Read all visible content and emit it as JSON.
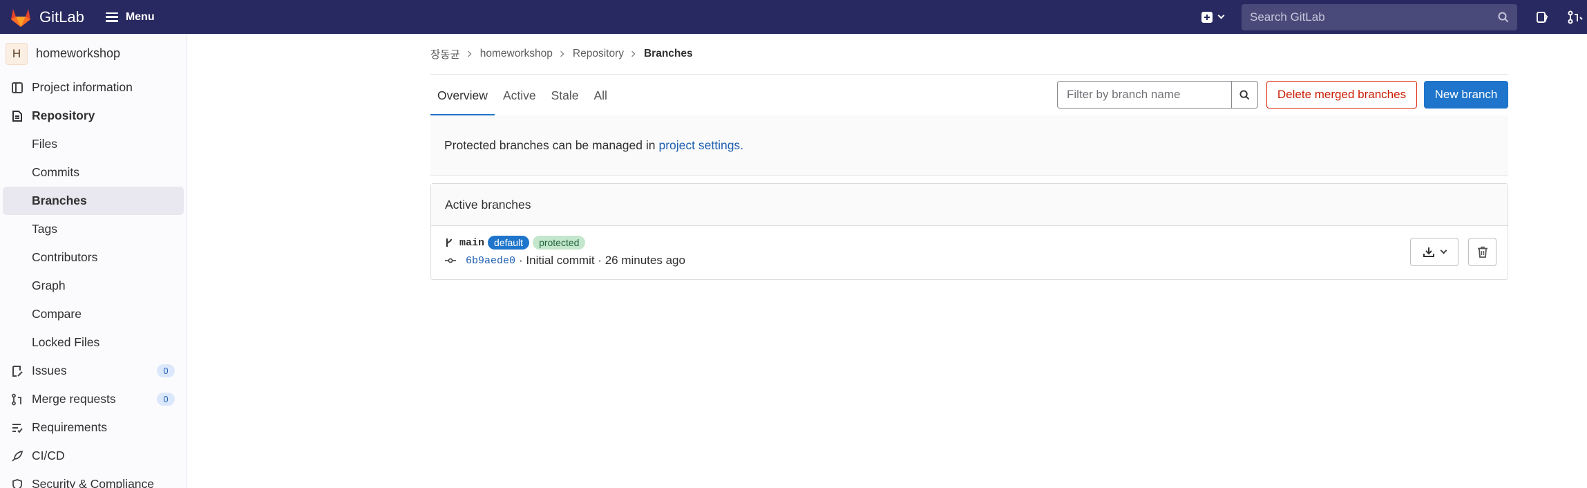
{
  "topbar": {
    "app_name": "GitLab",
    "menu_label": "Menu",
    "search_placeholder": "Search GitLab",
    "brand_color": "#292961"
  },
  "sidebar": {
    "project_initial": "H",
    "project_name": "homeworkshop",
    "items": [
      {
        "label": "Project information",
        "icon": "project-info-icon"
      },
      {
        "label": "Repository",
        "icon": "repository-icon"
      },
      {
        "label": "Files"
      },
      {
        "label": "Commits"
      },
      {
        "label": "Branches"
      },
      {
        "label": "Tags"
      },
      {
        "label": "Contributors"
      },
      {
        "label": "Graph"
      },
      {
        "label": "Compare"
      },
      {
        "label": "Locked Files"
      },
      {
        "label": "Issues",
        "icon": "issues-icon",
        "count": "0"
      },
      {
        "label": "Merge requests",
        "icon": "merge-request-icon",
        "count": "0"
      },
      {
        "label": "Requirements",
        "icon": "requirements-icon"
      },
      {
        "label": "CI/CD",
        "icon": "rocket-icon"
      },
      {
        "label": "Security & Compliance",
        "icon": "shield-icon"
      }
    ]
  },
  "breadcrumb": [
    "장동균",
    "homeworkshop",
    "Repository",
    "Branches"
  ],
  "tabs": [
    "Overview",
    "Active",
    "Stale",
    "All"
  ],
  "filter": {
    "placeholder": "Filter by branch name"
  },
  "buttons": {
    "delete_merged": "Delete merged branches",
    "new_branch": "New branch"
  },
  "notice": {
    "text": "Protected branches can be managed in",
    "link": "project settings."
  },
  "active_branches": {
    "title": "Active branches",
    "branches": [
      {
        "name": "main",
        "badges": [
          "default",
          "protected"
        ],
        "commit_sha": "6b9aede0",
        "commit_info": "· Initial commit · 26 minutes ago"
      }
    ]
  }
}
